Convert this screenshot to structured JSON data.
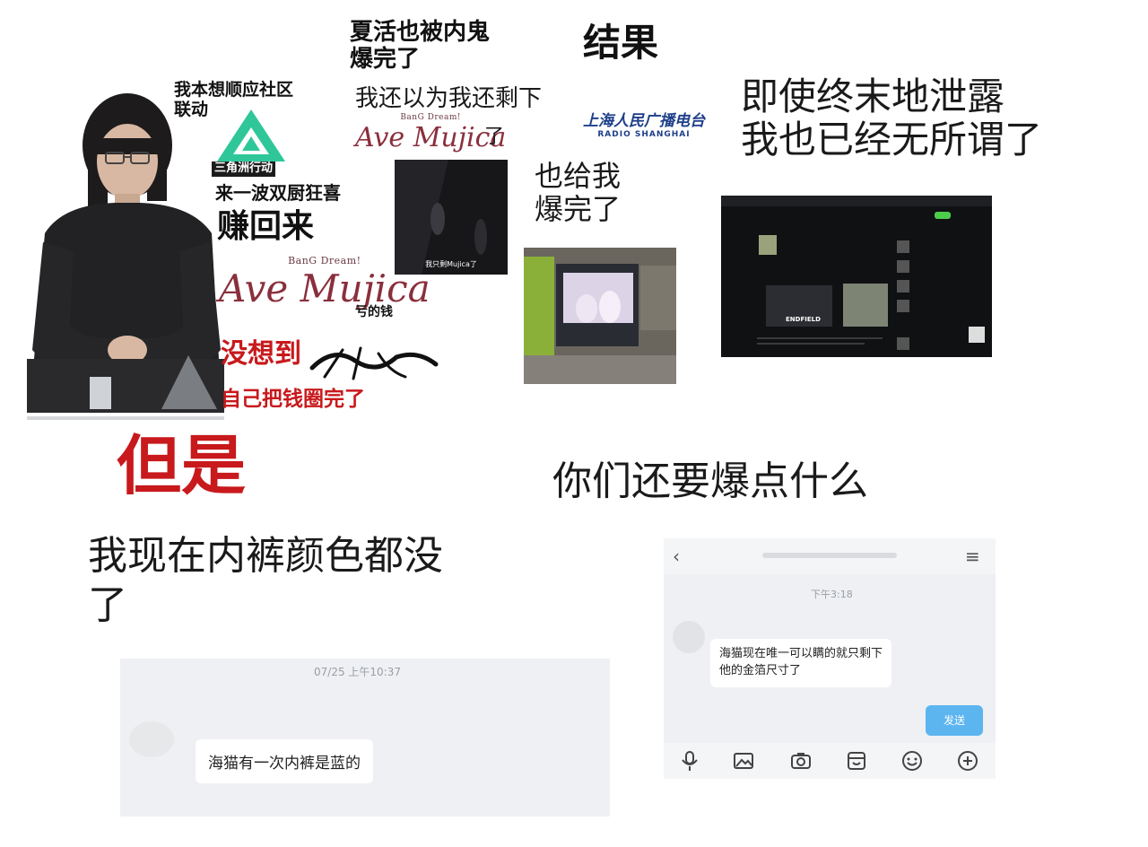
{
  "captions": {
    "community_collab": "我本想顺应社区\n联动",
    "triangle_logo_text": "三角洲行动",
    "double_kitchen": "来一波双厨狂喜",
    "earn_back": "赚回来",
    "lost_money": "亏的钱",
    "didnt_expect": "没想到",
    "circled_self": "自己把钱圈完了",
    "summer_event_leaked": "夏活也被内鬼\n爆完了",
    "thought_remaining": "我还以为我还剩下",
    "le_suffix": "了",
    "result": "结果",
    "also_for_me": "也给我\n爆完了",
    "end_leak": "即使终末地泄露\n我也已经无所谓了",
    "but": "但是",
    "underwear_color": "我现在内裤颜色都没\n了",
    "what_else": "你们还要爆点什么"
  },
  "logos": {
    "bangdream_small": "BanG Dream!",
    "ave_mujica": "Ave Mujica",
    "radio_cn": "上海人民广播电台",
    "radio_en": "RADIO SHANGHAI",
    "endfield": "ENDFIELD"
  },
  "anime_frame": {
    "subtitle": "我只剩Mujica了"
  },
  "chat_left": {
    "timestamp": "07/25 上午10:37",
    "message": "海猫有一次内裤是蓝的"
  },
  "chat_right": {
    "timestamp": "下午3:18",
    "message": "海猫现在唯一可以瞒的就只剩下\n他的金箔尺寸了",
    "send_label": "发送",
    "icons": [
      "microphone-icon",
      "image-icon",
      "camera-icon",
      "sticker-icon",
      "emoji-icon",
      "plus-icon"
    ]
  },
  "colors": {
    "red_text": "#c8191c",
    "triangle_green": "#2fc79a",
    "ave_maroon": "#8a2f3c",
    "radio_blue": "#1e3f8a",
    "send_blue": "#5db5f0"
  }
}
